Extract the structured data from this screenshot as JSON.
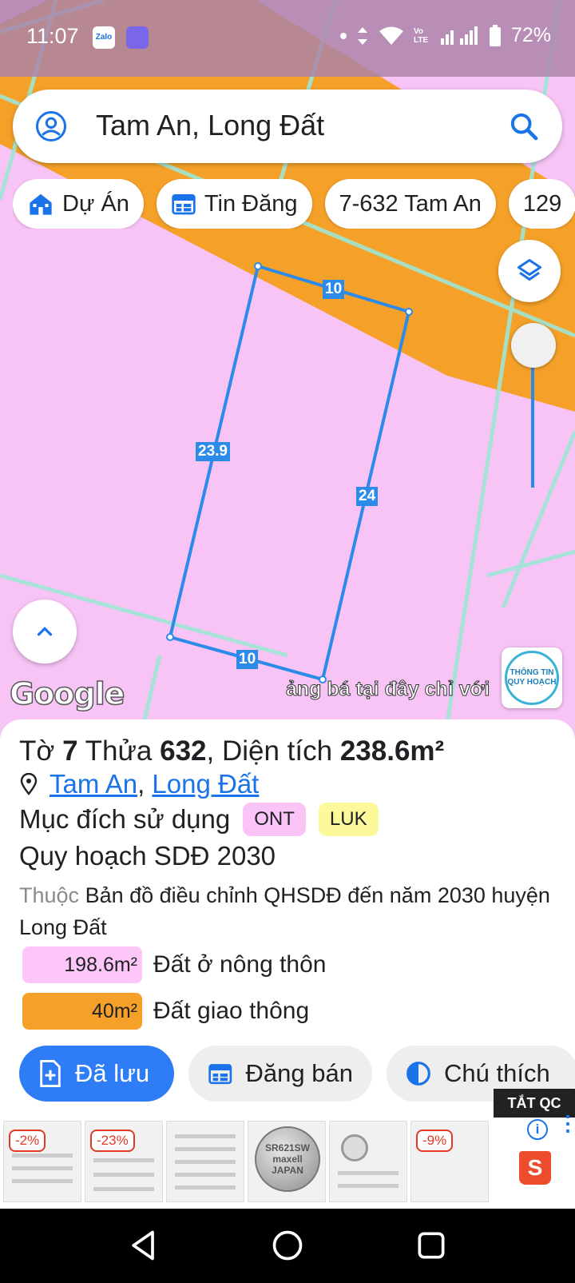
{
  "status_bar": {
    "time": "11:07",
    "zalo_label": "Zalo",
    "network": "Vo LTE",
    "battery": "72%"
  },
  "search": {
    "query": "Tam An, Long Đất"
  },
  "chips": [
    {
      "label": "Dự Án",
      "icon": "building-icon"
    },
    {
      "label": "Tin Đăng",
      "icon": "listing-icon"
    },
    {
      "label": "7-632 Tam An",
      "icon": ""
    },
    {
      "label": "129",
      "icon": ""
    }
  ],
  "map": {
    "edge_labels": {
      "top": "10",
      "left": "23.9",
      "right": "24",
      "bottom": "10"
    },
    "colors": {
      "residential": "#f7c4f5",
      "road": "#f5a129",
      "parcel_line": "#2c8ae8",
      "grid": "#9fe6d6"
    },
    "google_logo": "Google",
    "ad_ticker": "ảng bá tại đây chỉ với 1",
    "badge_line1": "THÔNG TIN",
    "badge_line2": "QUY HOẠCH"
  },
  "parcel": {
    "sheet_label": "Tờ",
    "sheet": "7",
    "lot_label": "Thửa",
    "lot": "632",
    "area_label": ", Diện tích",
    "area": "238.6m²",
    "location_commune": "Tam An",
    "location_sep": ",",
    "location_district": "Long Đất",
    "purpose_label": "Mục đích sử dụng",
    "purpose_tags": [
      "ONT",
      "LUK"
    ],
    "plan_title": "Quy hoạch SDĐ 2030",
    "desc_muted": "Thuộc",
    "desc_text": "Bản đồ điều chỉnh QHSDĐ đến năm 2030 huyện Long Đất",
    "breakdown": [
      {
        "value": "198.6m²",
        "label": "Đất ở nông thôn",
        "color": "#fcc6f8"
      },
      {
        "value": "40m²",
        "label": "Đất giao thông",
        "color": "#f5a129"
      }
    ]
  },
  "actions": {
    "saved": "Đã lưu",
    "sell": "Đăng bán",
    "legend": "Chú thích"
  },
  "ads": {
    "close_label": "TẮT QC",
    "discounts": [
      "-2%",
      "-23%",
      "-9%"
    ],
    "coin_text": "SR621SW maxell JAPAN",
    "info_label": "i",
    "shop_letter": "S"
  }
}
